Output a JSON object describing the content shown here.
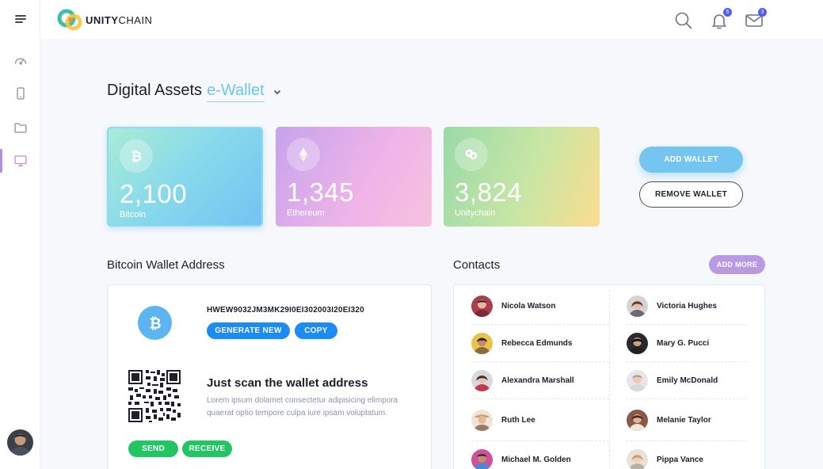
{
  "header": {
    "brand_bold": "UNITY",
    "brand_light": "CHAIN",
    "notifications_count": "5",
    "messages_count": "3"
  },
  "page": {
    "title": "Digital Assets",
    "title_accent": "e-Wallet"
  },
  "cards": [
    {
      "value": "2,100",
      "label": "Bitcoin",
      "icon": "bitcoin-icon"
    },
    {
      "value": "1,345",
      "label": "Ethereum",
      "icon": "ethereum-icon"
    },
    {
      "value": "3,824",
      "label": "Unitychain",
      "icon": "unitychain-icon"
    }
  ],
  "actions": {
    "add_wallet": "ADD WALLET",
    "remove_wallet": "REMOVE WALLET"
  },
  "wallet": {
    "section_title": "Bitcoin Wallet Address",
    "address": "HWEW9032JM3MK29I0EI302003I20EI320",
    "generate_label": "GENERATE NEW",
    "copy_label": "COPY",
    "scan_title": "Just scan the wallet address",
    "scan_desc": "Lorem ipsum dolamet consectetur adipisicing elimpora quaerat optio tempore culpa iure ipsam voluptatum.",
    "send_label": "SEND",
    "receive_label": "RECEIVE"
  },
  "contacts": {
    "section_title": "Contacts",
    "add_more_label": "ADD MORE",
    "left": [
      "Nicola Watson",
      "Rebecca Edmunds",
      "Alexandra Marshall",
      "Ruth Lee",
      "Michael M. Golden"
    ],
    "right": [
      "Victoria Hughes",
      "Mary G. Pucci",
      "Emily McDonald",
      "Melanie Taylor",
      "Pippa Vance"
    ]
  },
  "colors": {
    "accent_blue": "#74c6f0",
    "button_blue": "#1c8cf2",
    "button_green": "#22c563",
    "accent_purple": "#b999e2"
  }
}
